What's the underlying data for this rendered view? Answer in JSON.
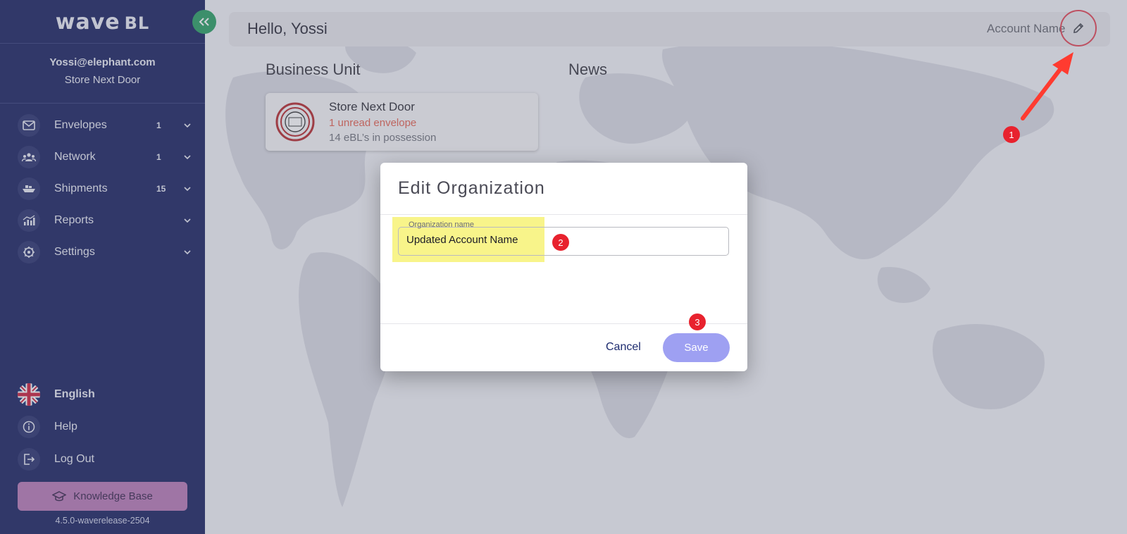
{
  "sidebar": {
    "logo": {
      "main": "wave",
      "suffix": "BL"
    },
    "user_email": "Yossi@elephant.com",
    "user_store": "Store Next Door",
    "nav": [
      {
        "label": "Envelopes",
        "count": "1",
        "icon": "envelope-icon"
      },
      {
        "label": "Network",
        "count": "1",
        "icon": "network-icon"
      },
      {
        "label": "Shipments",
        "count": "15",
        "icon": "ship-icon"
      },
      {
        "label": "Reports",
        "count": "",
        "icon": "reports-icon"
      },
      {
        "label": "Settings",
        "count": "",
        "icon": "settings-icon"
      }
    ],
    "bottom": [
      {
        "label": "English",
        "icon": "uk-flag-icon"
      },
      {
        "label": "Help",
        "icon": "info-icon"
      },
      {
        "label": "Log Out",
        "icon": "logout-icon"
      }
    ],
    "knowledge_base_label": "Knowledge Base",
    "version": "4.5.0-waverelease-2504"
  },
  "header": {
    "greeting": "Hello, Yossi",
    "account_name": "Account Name"
  },
  "sections": {
    "business_unit": "Business Unit",
    "news": "News"
  },
  "business_unit_card": {
    "name": "Store Next Door",
    "unread": "1 unread envelope",
    "ebls": "14 eBL’s in possession"
  },
  "modal": {
    "title": "Edit Organization",
    "field_label": "Organization name",
    "field_value": "Updated Account Name",
    "cancel_label": "Cancel",
    "save_label": "Save"
  },
  "annotations": {
    "step1": "1",
    "step2": "2",
    "step3": "3"
  },
  "colors": {
    "sidebar_bg": "#0b1457",
    "collapse_btn": "#1d9a5a",
    "knowledge_base_btn": "#b472b3",
    "save_btn": "#9ea0f2",
    "unread_text": "#e35a47",
    "annotation_red": "#e8222e",
    "highlight_yellow": "#f8f48a"
  }
}
